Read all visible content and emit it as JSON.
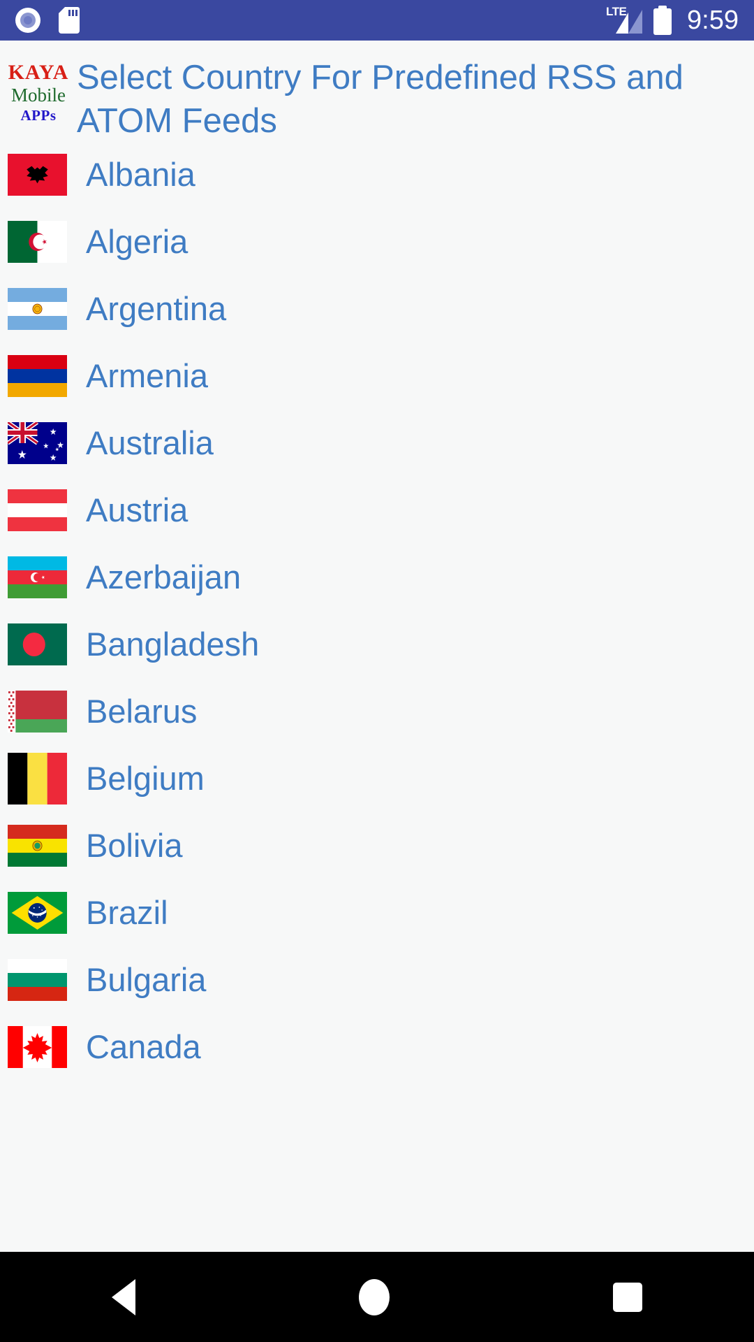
{
  "statusbar": {
    "time": "9:59",
    "network_label": "LTE",
    "icons": [
      "recording-circle-icon",
      "sd-card-icon",
      "lte-signal-icon",
      "battery-icon"
    ]
  },
  "header": {
    "logo": {
      "line1": "KAYA",
      "line2": "Mobile",
      "line3": "APPs"
    },
    "title": "Select Country For Predefined RSS and ATOM Feeds"
  },
  "colors": {
    "statusbar_bg": "#3a48a0",
    "page_bg": "#f7f8f8",
    "accent_text": "#3f7cc3",
    "logo_red": "#d81f16",
    "logo_green": "#1f6b2e",
    "logo_blue": "#2218c9",
    "navbar_bg": "#000000"
  },
  "list": {
    "items": [
      {
        "name": "Albania",
        "flag": "albania"
      },
      {
        "name": "Algeria",
        "flag": "algeria"
      },
      {
        "name": "Argentina",
        "flag": "argentina"
      },
      {
        "name": "Armenia",
        "flag": "armenia"
      },
      {
        "name": "Australia",
        "flag": "australia"
      },
      {
        "name": "Austria",
        "flag": "austria"
      },
      {
        "name": "Azerbaijan",
        "flag": "azerbaijan"
      },
      {
        "name": "Bangladesh",
        "flag": "bangladesh"
      },
      {
        "name": "Belarus",
        "flag": "belarus"
      },
      {
        "name": "Belgium",
        "flag": "belgium"
      },
      {
        "name": "Bolivia",
        "flag": "bolivia"
      },
      {
        "name": "Brazil",
        "flag": "brazil"
      },
      {
        "name": "Bulgaria",
        "flag": "bulgaria"
      },
      {
        "name": "Canada",
        "flag": "canada"
      }
    ]
  },
  "navbar": {
    "back_label": "Back",
    "home_label": "Home",
    "recents_label": "Recents"
  }
}
